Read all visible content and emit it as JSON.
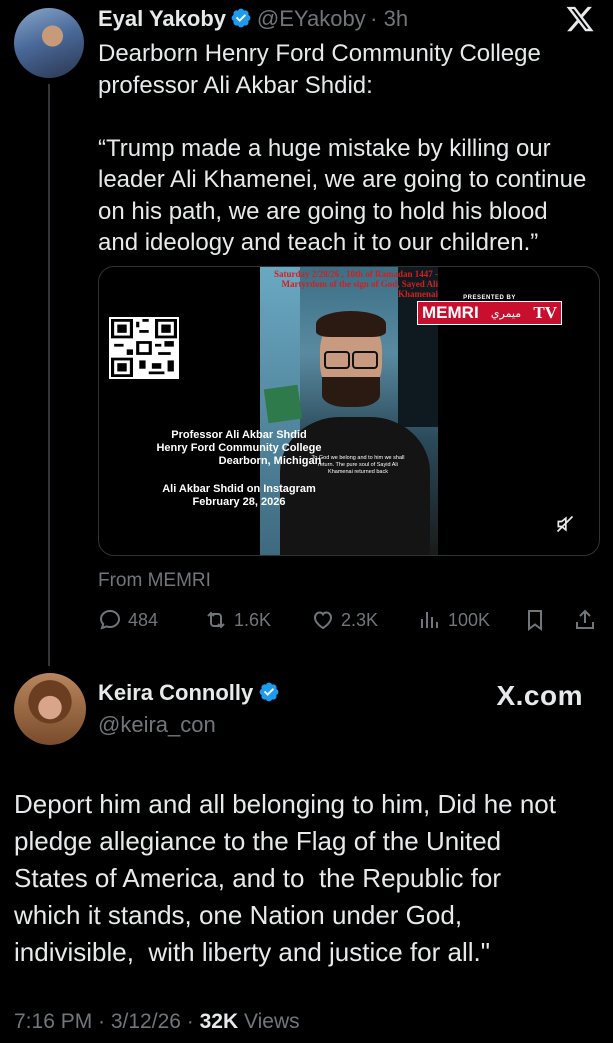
{
  "tweet1": {
    "display_name": "Eyal Yakoby",
    "handle": "@EYakoby",
    "time": "· 3h",
    "body": "Dearborn Henry Ford Community College\nprofessor Ali Akbar Shdid:\n\n“Trump made a huge mistake by killing our\nleader Ali Khamenei, we are going to continue\non his path, we are going to hold his blood\nand ideology and teach it to our children.”",
    "from": "From MEMRI",
    "media": {
      "headline": "Saturday 2/28/26 , 10th of Ramadan 1447 - Martyrdom of the sign of God, Sayed Ali Khamenai",
      "presented_by": "PRESENTED BY",
      "brand": "MEMRI",
      "brand_ar": "ميمري",
      "brand_tv": "TV",
      "caption_name": "Professor Ali Akbar Shdid",
      "caption_college": "Henry Ford Community College",
      "caption_city": "Dearborn, Michigan",
      "caption_source": "Ali Akbar Shdid on Instagram",
      "caption_date": "February 28, 2026",
      "overlay_text": "To God we belong and to him we shall return. The pure soul of Sayid Ali Khamenai returned back"
    },
    "actions": {
      "replies": "484",
      "reposts": "1.6K",
      "likes": "2.3K",
      "views": "100K"
    }
  },
  "tweet2": {
    "display_name": "Keira Connolly",
    "handle": "@keira_con",
    "body": "Deport him and all belonging to him, Did he not\npledge allegiance to the Flag of the United\nStates of America, and to  the Republic for\nwhich it stands, one Nation under God,\nindivisible,  with liberty and justice for all.\"",
    "time": "7:16 PM · 3/12/26 · ",
    "views_count": "32K",
    "views_label": "Views"
  },
  "watermark": "X.com",
  "colors": {
    "verified": "#1d9bf0",
    "muted": "#71767b",
    "memri_red": "#c8102e"
  },
  "icons": [
    "x-logo-icon",
    "verified-badge-icon",
    "reply-icon",
    "repost-icon",
    "like-icon",
    "views-icon",
    "bookmark-icon",
    "share-icon",
    "muted-audio-icon",
    "qr-code"
  ]
}
